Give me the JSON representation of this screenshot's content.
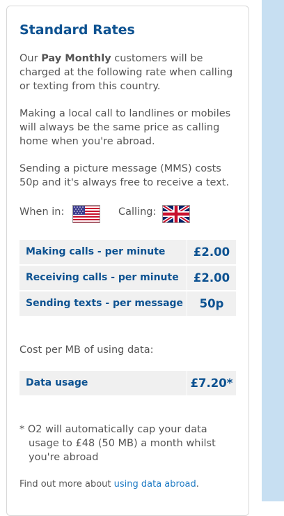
{
  "card": {
    "title": "Standard Rates",
    "intro_prefix": "Our ",
    "intro_bold": "Pay Monthly",
    "intro_suffix": " customers will be charged at the following rate when calling or texting from this country.",
    "local_call_text": "Making a local call to landlines or mobiles will always be the same price as calling home when you're abroad.",
    "mms_text": "Sending a picture message (MMS) costs 50p and it's always free to receive a text.",
    "when_in_label": "When in:",
    "calling_label": "Calling:",
    "when_in_flag": "us-flag-icon",
    "calling_flag": "uk-flag-icon"
  },
  "rates": [
    {
      "label": "Making calls - per minute",
      "value": "£2.00"
    },
    {
      "label": "Receiving calls - per minute",
      "value": "£2.00"
    },
    {
      "label": "Sending texts - per message",
      "value": "50p"
    }
  ],
  "data": {
    "cost_label": "Cost per MB of using data:",
    "usage_label": "Data usage",
    "usage_value": "£7.20*"
  },
  "footnote": {
    "line1": "* O2 will automatically cap your data",
    "line2": "usage to £48 (50 MB) a month whilst",
    "line3": "you're abroad"
  },
  "find_out": {
    "prefix": "Find out more about ",
    "link": "using data abroad",
    "suffix": "."
  },
  "colors": {
    "heading_blue": "#0d5291",
    "link_blue": "#1f7bc4",
    "row_bg": "#f0f0f0",
    "side_bar": "#c7dff2"
  }
}
